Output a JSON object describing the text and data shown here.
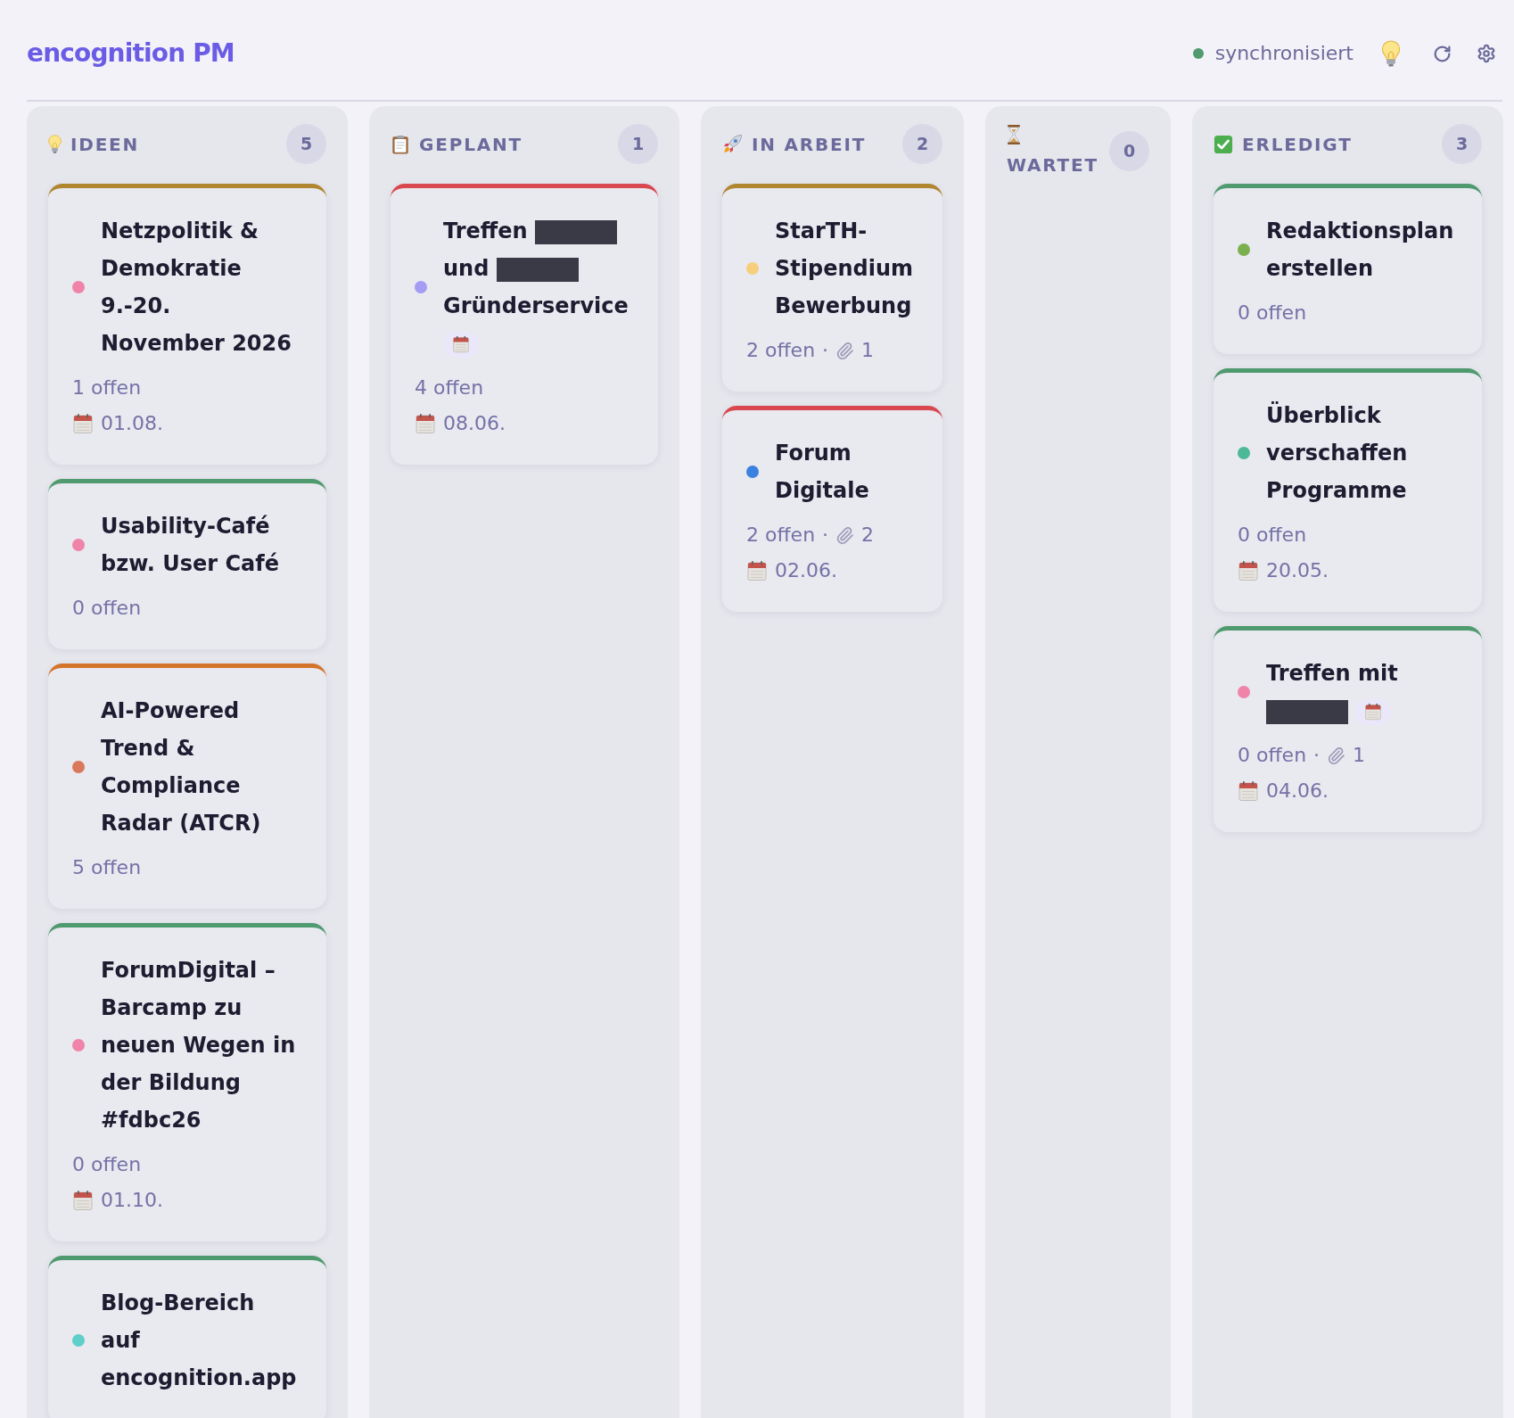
{
  "app": {
    "title": "encognition PM"
  },
  "sync": {
    "label": "synchronisiert",
    "synced": true
  },
  "columns": [
    {
      "kind": "ideas",
      "label": "IDEEN",
      "count": "5",
      "cards": [
        {
          "title": [
            {
              "kind": "text",
              "text": "Netzpolitik & Demokratie 9.-20. November 2026"
            }
          ],
          "bar": {
            "color": "#b0862e"
          },
          "color": "#ef84a8",
          "calendar_linked": false,
          "open": "1 offen",
          "due": "01.08."
        },
        {
          "title": [
            {
              "kind": "text",
              "text": "Usability-Café bzw. User Café"
            }
          ],
          "bar": {
            "color": "#4f9a6e"
          },
          "color": "#ef84a8",
          "calendar_linked": false,
          "open": "0 offen"
        },
        {
          "title": [
            {
              "kind": "text",
              "text": "AI-Powered Trend & Compliance Radar (ATCR)"
            }
          ],
          "bar": {
            "color": "#d4742a"
          },
          "color": "#d9785a",
          "calendar_linked": false,
          "open": "5 offen"
        },
        {
          "title": [
            {
              "kind": "text",
              "text": "ForumDigital – Barcamp zu neuen Wegen in der Bildung #fdbc26"
            }
          ],
          "bar": {
            "color": "#4f9a6e"
          },
          "color": "#ef84a8",
          "calendar_linked": false,
          "open": "0 offen",
          "due": "01.10."
        },
        {
          "title": [
            {
              "kind": "text",
              "text": "Blog-Bereich auf encognition.app"
            }
          ],
          "bar": {
            "color": "#4f9a6e"
          },
          "color": "#5ecfc9",
          "calendar_linked": false
        }
      ]
    },
    {
      "kind": "planned",
      "label": "GEPLANT",
      "count": "1",
      "cards": [
        {
          "title": [
            {
              "kind": "text",
              "text": "Treffen"
            },
            {
              "kind": "redacted"
            },
            {
              "kind": "text",
              "text": "und"
            },
            {
              "kind": "redacted"
            },
            {
              "kind": "text",
              "text": "Gründerservice"
            }
          ],
          "bar": {
            "color": "#d9474f"
          },
          "color": "#a59cf4",
          "calendar_linked": true,
          "open": "4 offen",
          "due": "08.06."
        }
      ]
    },
    {
      "kind": "active",
      "label": "IN ARBEIT",
      "count": "2",
      "cards": [
        {
          "title": [
            {
              "kind": "text",
              "text": "StarTH-Stipendium Bewerbung"
            }
          ],
          "bar": {
            "color": "#b0862e"
          },
          "color": "#f6cf7c",
          "calendar_linked": false,
          "open": "2 offen",
          "attachments": {
            "separator": "·",
            "count": "1"
          }
        },
        {
          "title": [
            {
              "kind": "text",
              "text": "Forum Digitale"
            }
          ],
          "bar": {
            "color": "#d9474f"
          },
          "color": "#3b82e0",
          "calendar_linked": false,
          "open": "2 offen",
          "attachments": {
            "separator": "·",
            "count": "2"
          },
          "due": "02.06."
        }
      ]
    },
    {
      "kind": "waiting",
      "label": "WARTET",
      "count": "0"
    },
    {
      "kind": "done",
      "label": "ERLEDIGT",
      "count": "3",
      "cards": [
        {
          "title": [
            {
              "kind": "text",
              "text": "Redaktionsplan erstellen"
            }
          ],
          "bar": {
            "color": "#4f9a6e"
          },
          "color": "#7cb04f",
          "calendar_linked": false,
          "open": "0 offen"
        },
        {
          "title": [
            {
              "kind": "text",
              "text": "Überblick verschaffen Programme"
            }
          ],
          "bar": {
            "color": "#4f9a6e"
          },
          "color": "#4db896",
          "calendar_linked": false,
          "open": "0 offen",
          "due": "20.05."
        },
        {
          "title": [
            {
              "kind": "text",
              "text": "Treffen mit"
            },
            {
              "kind": "redacted"
            }
          ],
          "bar": {
            "color": "#4f9a6e"
          },
          "color": "#ef84a8",
          "calendar_linked": true,
          "open": "0 offen",
          "attachments": {
            "separator": "·",
            "count": "1"
          },
          "due": "04.06."
        }
      ]
    }
  ]
}
